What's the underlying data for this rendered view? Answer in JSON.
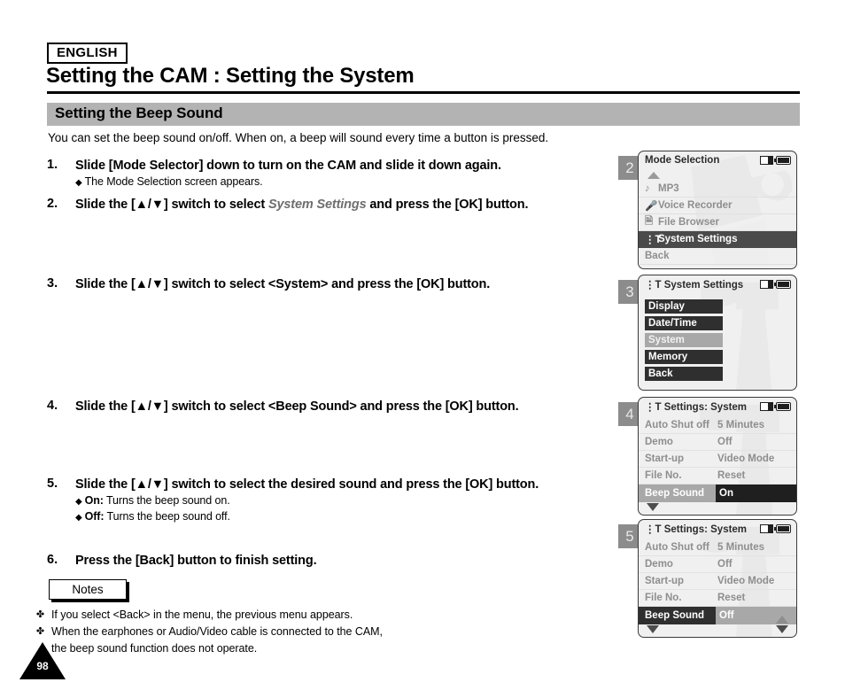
{
  "header": {
    "language_badge": "ENGLISH",
    "title": "Setting the CAM : Setting the System",
    "section_title": "Setting the Beep Sound",
    "intro": "You can set the beep sound on/off. When on, a beep will sound every time a button is pressed."
  },
  "steps": [
    {
      "number": "1.",
      "text": "Slide [Mode Selector] down to turn on the CAM and slide it down again.",
      "sub": [
        {
          "marker": "◆",
          "bold": "",
          "text": "The Mode Selection screen appears."
        }
      ]
    },
    {
      "number": "2.",
      "text_before": "Slide the [▲/▼] switch to select ",
      "text_italic": "System Settings",
      "text_after": " and press the [OK] button.",
      "sub": []
    },
    {
      "number": "3.",
      "text": "Slide the [▲/▼] switch to select <System> and press the [OK] button.",
      "sub": []
    },
    {
      "number": "4.",
      "text": "Slide the [▲/▼] switch to select <Beep Sound> and press the [OK] button.",
      "sub": []
    },
    {
      "number": "5.",
      "text": "Slide the [▲/▼] switch to select the desired sound and press the [OK] button.",
      "sub": [
        {
          "marker": "◆",
          "bold": "On:",
          "text": " Turns the beep sound on."
        },
        {
          "marker": "◆",
          "bold": "Off:",
          "text": " Turns the beep sound off."
        }
      ]
    },
    {
      "number": "6.",
      "text": "Press the [Back] button to finish setting.",
      "sub": []
    }
  ],
  "notes": {
    "label": "Notes",
    "marker": "✤",
    "items": [
      "If you select <Back> in the menu, the previous menu appears.",
      "When the earphones or Audio/Video cable is connected to the CAM,",
      "the beep sound function does not operate."
    ]
  },
  "page_number": "98",
  "panels": [
    {
      "badge": "2",
      "title": "Mode Selection",
      "type": "mode-list",
      "status_icons": [
        "memory-card-icon",
        "battery-icon"
      ],
      "show_up_arrow": true,
      "items": [
        {
          "icon": "music-note-icon",
          "label": "MP3",
          "selected": false
        },
        {
          "icon": "microphone-icon",
          "label": "Voice Recorder",
          "selected": false
        },
        {
          "icon": "file-browser-icon",
          "label": "File Browser",
          "selected": false
        },
        {
          "icon": "settings-tools-icon",
          "label": "System Settings",
          "selected": true
        },
        {
          "icon": "",
          "label": "Back",
          "selected": false
        }
      ]
    },
    {
      "badge": "3",
      "title": "System Settings",
      "title_icon": "settings-tools-icon",
      "type": "block-list",
      "status_icons": [
        "memory-card-icon",
        "battery-icon"
      ],
      "items": [
        {
          "label": "Display",
          "selected": false
        },
        {
          "label": "Date/Time",
          "selected": false
        },
        {
          "label": "System",
          "selected": true
        },
        {
          "label": "Memory",
          "selected": false
        },
        {
          "label": "Back",
          "selected": false
        }
      ]
    },
    {
      "badge": "4",
      "title": "Settings: System",
      "title_icon": "settings-tools-icon",
      "type": "table",
      "status_icons": [
        "memory-card-icon",
        "battery-icon"
      ],
      "rows": [
        {
          "key": "Auto Shut off",
          "value": "5 Minutes",
          "highlight": false
        },
        {
          "key": "Demo",
          "value": "Off",
          "highlight": false
        },
        {
          "key": "Start-up",
          "value": "Video Mode",
          "highlight": false
        },
        {
          "key": "File No.",
          "value": "Reset",
          "highlight": false
        },
        {
          "key": "Beep Sound",
          "value": "On",
          "highlight": true,
          "inverted": false
        }
      ],
      "scroll_down": true,
      "scroll_up_right": false,
      "scroll_down_right": false
    },
    {
      "badge": "5",
      "title": "Settings: System",
      "title_icon": "settings-tools-icon",
      "type": "table",
      "status_icons": [
        "memory-card-icon",
        "battery-icon"
      ],
      "rows": [
        {
          "key": "Auto Shut off",
          "value": "5 Minutes",
          "highlight": false
        },
        {
          "key": "Demo",
          "value": "Off",
          "highlight": false
        },
        {
          "key": "Start-up",
          "value": "Video Mode",
          "highlight": false
        },
        {
          "key": "File No.",
          "value": "Reset",
          "highlight": false
        },
        {
          "key": "Beep Sound",
          "value": "Off",
          "highlight": true,
          "inverted": true
        }
      ],
      "scroll_down": true,
      "scroll_up_right": true,
      "scroll_down_right": true
    }
  ]
}
